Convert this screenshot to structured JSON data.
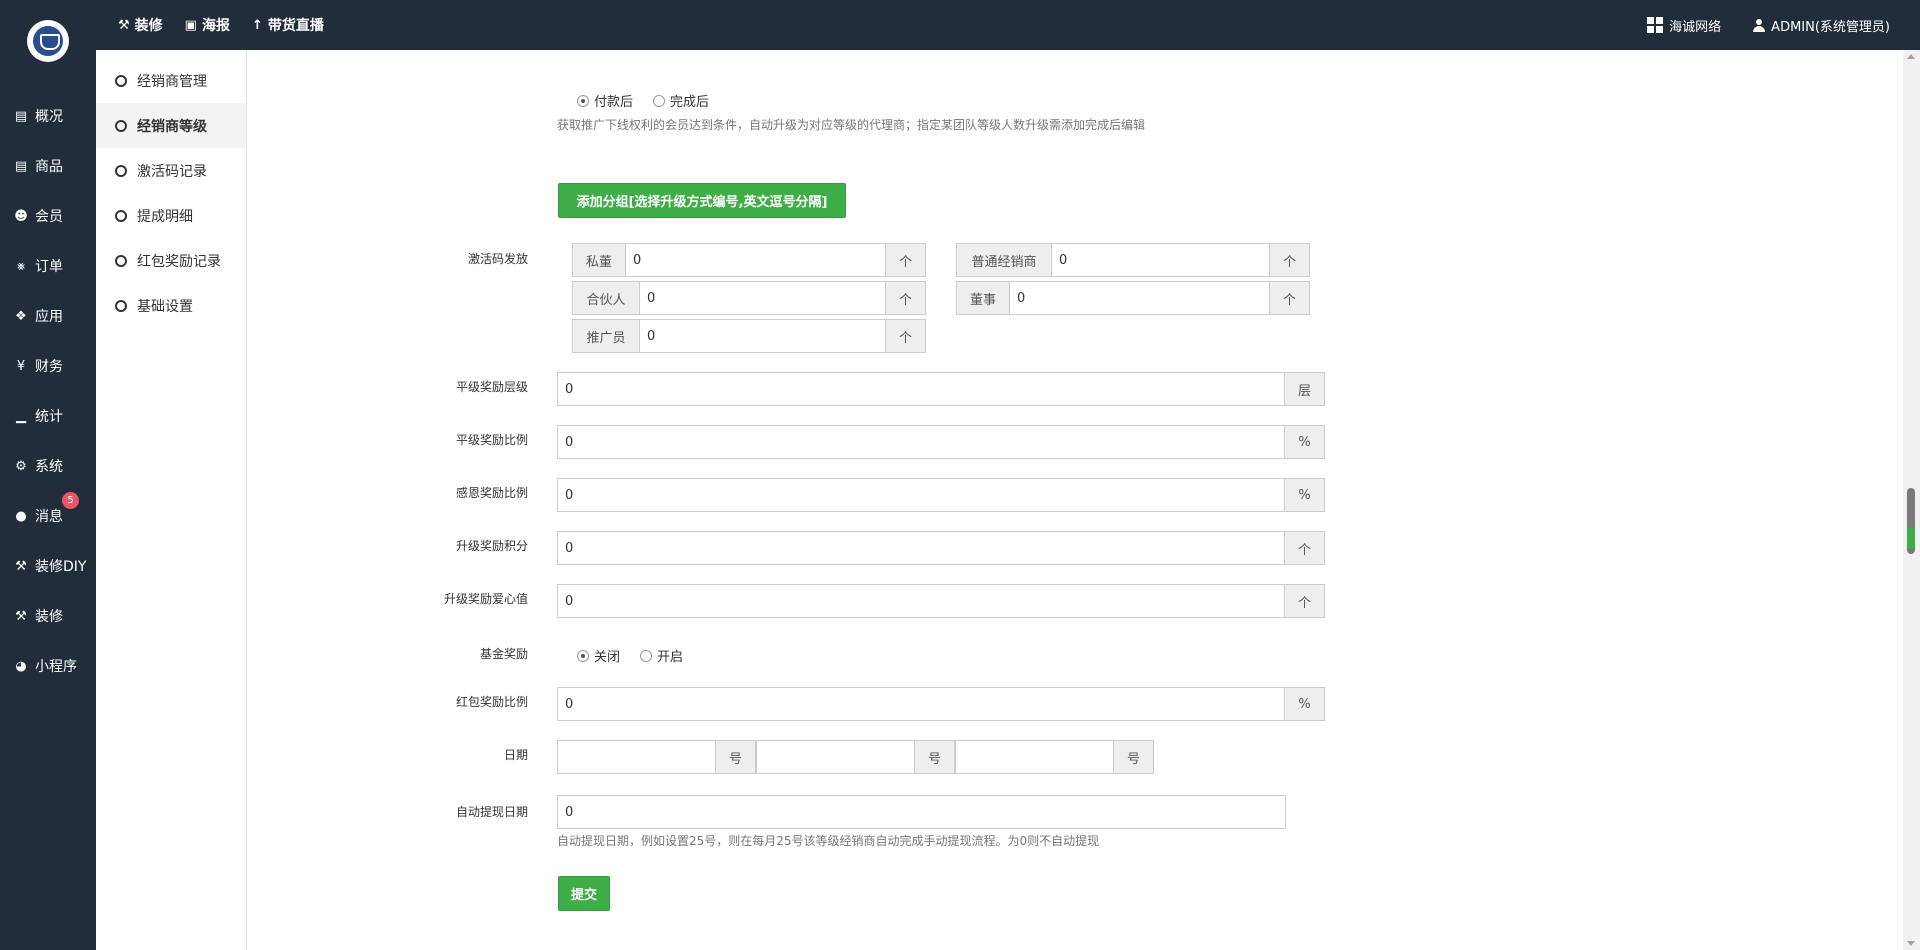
{
  "topbar": {
    "nav": [
      {
        "icon": "hammer-icon",
        "glyph": "⚒",
        "label": "装修"
      },
      {
        "icon": "image-icon",
        "glyph": "▣",
        "label": "海报"
      },
      {
        "icon": "torch-icon",
        "glyph": "↑",
        "label": "带货直播"
      }
    ],
    "brand_label": "海诚网络",
    "user_label": "ADMIN(系统管理员)"
  },
  "mainside": {
    "items": [
      {
        "icon": "box-icon",
        "glyph": "▤",
        "label": "概况"
      },
      {
        "icon": "box-icon",
        "glyph": "▤",
        "label": "商品"
      },
      {
        "icon": "users-icon",
        "glyph": "☻",
        "label": "会员"
      },
      {
        "icon": "cart-icon",
        "glyph": "⨳",
        "label": "订单"
      },
      {
        "icon": "cubes-icon",
        "glyph": "❖",
        "label": "应用"
      },
      {
        "icon": "yen-icon",
        "glyph": "¥",
        "label": "财务"
      },
      {
        "icon": "bar-chart-icon",
        "glyph": "▁",
        "label": "统计"
      },
      {
        "icon": "cogs-icon",
        "glyph": "⚙",
        "label": "系统"
      },
      {
        "icon": "comment-icon",
        "glyph": "●",
        "label": "消息",
        "badge": "5"
      },
      {
        "icon": "hammer-icon",
        "glyph": "⚒",
        "label": "装修DIY"
      },
      {
        "icon": "hammer-icon",
        "glyph": "⚒",
        "label": "装修"
      },
      {
        "icon": "wechat-icon",
        "glyph": "◕",
        "label": "小程序"
      }
    ]
  },
  "subside": {
    "items": [
      {
        "label": "经销商管理",
        "active": false
      },
      {
        "label": "经销商等级",
        "active": true
      },
      {
        "label": "激活码记录",
        "active": false
      },
      {
        "label": "提成明细",
        "active": false
      },
      {
        "label": "红包奖励记录",
        "active": false
      },
      {
        "label": "基础设置",
        "active": false
      }
    ]
  },
  "form": {
    "upgrade_timing": {
      "options": [
        "付款后",
        "完成后"
      ],
      "selected": 0
    },
    "upgrade_help": "获取推广下线权利的会员达到条件，自动升级为对应等级的代理商；指定某团队等级人数升级需添加完成后编辑",
    "add_group_button": "添加分组[选择升级方式编号,英文逗号分隔]",
    "activation": {
      "label": "激活码发放",
      "unit": "个",
      "fields": [
        {
          "name": "私董",
          "value": "0"
        },
        {
          "name": "普通经销商",
          "value": "0"
        },
        {
          "name": "合伙人",
          "value": "0"
        },
        {
          "name": "董事",
          "value": "0"
        },
        {
          "name": "推广员",
          "value": "0"
        }
      ]
    },
    "peer_levels": {
      "label": "平级奖励层级",
      "value": "0",
      "unit": "层"
    },
    "peer_ratio": {
      "label": "平级奖励比例",
      "value": "0",
      "unit": "%"
    },
    "gratitude_ratio": {
      "label": "感恩奖励比例",
      "value": "0",
      "unit": "%"
    },
    "upgrade_points": {
      "label": "升级奖励积分",
      "value": "0",
      "unit": "个"
    },
    "upgrade_love": {
      "label": "升级奖励爱心值",
      "value": "0",
      "unit": "个"
    },
    "fund": {
      "label": "基金奖励",
      "options": [
        "关闭",
        "开启"
      ],
      "selected": 0
    },
    "redpacket_ratio": {
      "label": "红包奖励比例",
      "value": "0",
      "unit": "%"
    },
    "date": {
      "label": "日期",
      "unit": "号",
      "values": [
        "",
        "",
        ""
      ]
    },
    "auto_withdraw": {
      "label": "自动提现日期",
      "value": "0",
      "help": "自动提现日期，例如设置25号，则在每月25号该等级经销商自动完成手动提现流程。为0则不自动提现"
    },
    "submit_button": "提交"
  }
}
